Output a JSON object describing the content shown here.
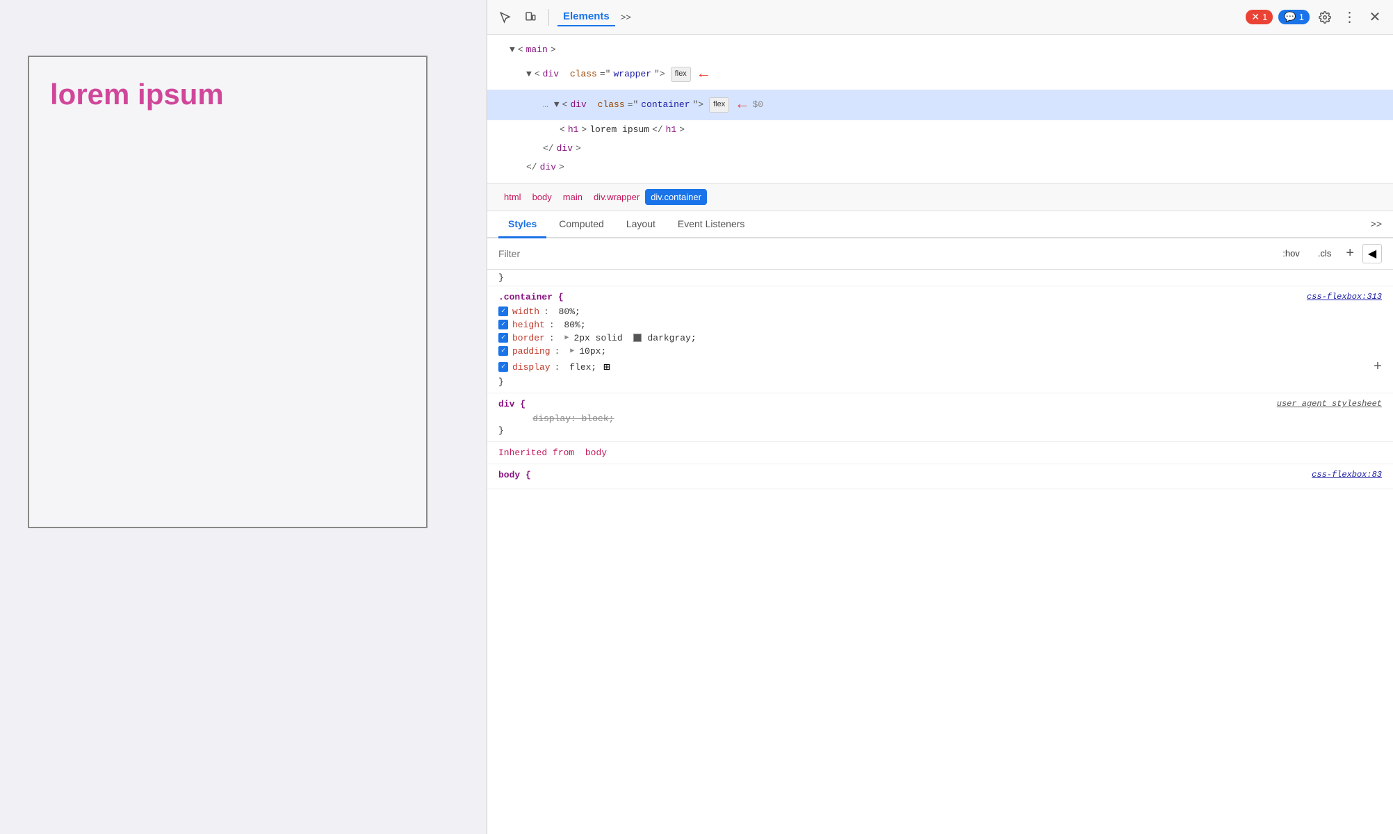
{
  "browser": {
    "content": {
      "lorem_text": "lorem ipsum"
    }
  },
  "devtools": {
    "toolbar": {
      "tabs": [
        "Elements"
      ],
      "active_tab": "Elements",
      "badges": {
        "error": "1",
        "message": "1"
      }
    },
    "html_tree": {
      "lines": [
        {
          "indent": 1,
          "content": "<main>",
          "type": "open",
          "tag": "main",
          "id": "line-main"
        },
        {
          "indent": 2,
          "content": "<div class=\"wrapper\">",
          "tag": "div",
          "class": "wrapper",
          "flex": true,
          "arrow": true,
          "id": "line-wrapper"
        },
        {
          "indent": 3,
          "content": "<div class=\"container\">",
          "tag": "div",
          "class": "container",
          "flex": true,
          "arrow": true,
          "selected": true,
          "dots": true,
          "id": "line-container"
        },
        {
          "indent": 4,
          "content": "<h1>lorem ipsum</h1>",
          "tag": "h1",
          "inner": "lorem ipsum",
          "id": "line-h1"
        },
        {
          "indent": 3,
          "content": "</div>",
          "closing": true,
          "id": "line-close-div"
        },
        {
          "indent": 2,
          "content": "</div>",
          "closing": true,
          "id": "line-close-wrapper"
        }
      ]
    },
    "breadcrumb": {
      "items": [
        "html",
        "body",
        "main",
        "div.wrapper",
        "div.container"
      ],
      "active": "div.container"
    },
    "panels": {
      "tabs": [
        "Styles",
        "Computed",
        "Layout",
        "Event Listeners"
      ],
      "active": "Styles",
      "more": ">>"
    },
    "filter": {
      "placeholder": "Filter",
      "hov_btn": ":hov",
      "cls_btn": ".cls",
      "plus_btn": "+",
      "palette_btn": "◀"
    },
    "styles": {
      "partial_top": "}",
      "sections": [
        {
          "selector": ".container {",
          "source": "css-flexbox:313",
          "id": "section-container",
          "props": [
            {
              "checked": true,
              "name": "width",
              "value": "80%",
              "id": "prop-width"
            },
            {
              "checked": true,
              "name": "height",
              "value": "80%",
              "id": "prop-height"
            },
            {
              "checked": true,
              "name": "border",
              "name_extra": "▶ 2px solid",
              "color": "darkgray",
              "value": "darkgray;",
              "has_color": true,
              "id": "prop-border"
            },
            {
              "checked": true,
              "name": "padding",
              "name_extra": "▶ 10px",
              "value": "10px;",
              "id": "prop-padding"
            },
            {
              "checked": true,
              "name": "display",
              "value": "flex;",
              "has_grid_icon": true,
              "id": "prop-display"
            }
          ],
          "close_brace": "}"
        },
        {
          "selector": "div {",
          "source": "user agent stylesheet",
          "id": "section-div",
          "props": [
            {
              "checked": false,
              "name": "display: block;",
              "strikethrough": true,
              "id": "prop-display-block"
            }
          ],
          "close_brace": "}"
        }
      ],
      "inherited_from": {
        "label": "Inherited from",
        "element": "body"
      },
      "inherited_source": "css-flexbox:83",
      "body_selector": "body {"
    }
  }
}
